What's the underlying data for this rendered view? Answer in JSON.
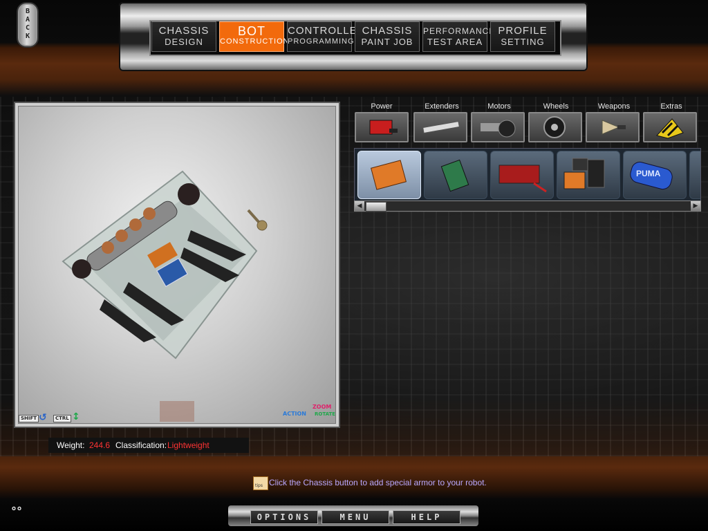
{
  "back_label": "BACK",
  "nav": {
    "tabs": [
      {
        "line1": "CHASSIS",
        "line2": "DESIGN",
        "active": false
      },
      {
        "line1": "BOT",
        "line2": "CONSTRUCTION",
        "active": true
      },
      {
        "line1": "CONTROLLER",
        "line2": "PROGRAMMING",
        "active": false
      },
      {
        "line1": "CHASSIS",
        "line2": "PAINT JOB",
        "active": false
      },
      {
        "line1": "PERFORMANCE",
        "line2": "TEST AREA",
        "active": false
      },
      {
        "line1": "PROFILE",
        "line2": "SETTING",
        "active": false
      }
    ]
  },
  "viewport": {
    "keys": {
      "shift": "SHIFT",
      "ctrl": "CTRL"
    },
    "legend": {
      "action": "ACTION",
      "zoom": "ZOOM",
      "rotate": "ROTATE"
    }
  },
  "categories": [
    {
      "label": "Power",
      "icon": "battery-icon"
    },
    {
      "label": "Extenders",
      "icon": "extender-bar-icon"
    },
    {
      "label": "Motors",
      "icon": "motor-icon"
    },
    {
      "label": "Wheels",
      "icon": "wheel-icon"
    },
    {
      "label": "Weapons",
      "icon": "blade-icon"
    },
    {
      "label": "Extras",
      "icon": "hazard-icon"
    }
  ],
  "parts": [
    {
      "icon": "orange-battery-icon",
      "selected": true
    },
    {
      "icon": "circuit-board-icon",
      "selected": false
    },
    {
      "icon": "red-battery-pack-icon",
      "selected": false
    },
    {
      "icon": "battery-cells-icon",
      "selected": false
    },
    {
      "icon": "puma-battery-icon",
      "label": "PUMA",
      "selected": false
    }
  ],
  "status": {
    "weight_label": "Weight:",
    "weight_value": "244.6",
    "class_label": "Classification:",
    "class_value": "Lightweight"
  },
  "tip": {
    "icon_label": "tips",
    "text": "Click the Chassis button to add special armor to your robot."
  },
  "bottom_menu": [
    "OPTIONS",
    "MENU",
    "HELP"
  ],
  "colors": {
    "accent": "#f26a0c",
    "value_red": "#ff3333",
    "tip_text": "#b9a8ff"
  }
}
